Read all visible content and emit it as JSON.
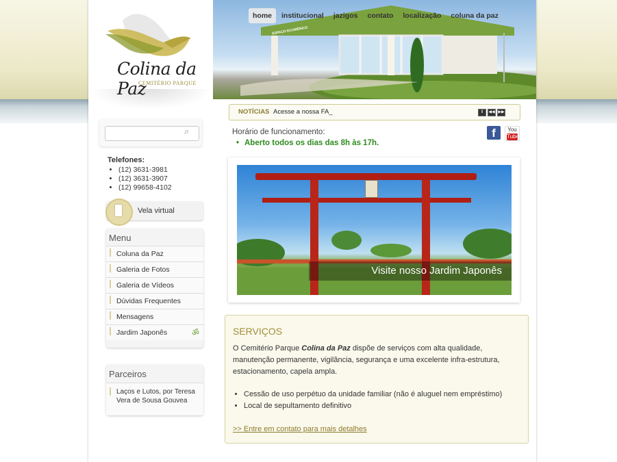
{
  "logo": {
    "name": "Colina da Paz",
    "sub": "CEMITÉRIO PARQUE"
  },
  "search": {
    "placeholder": ""
  },
  "phones": {
    "title": "Telefones:",
    "items": [
      "(12) 3631-3981",
      "(12) 3631-3907",
      "(12) 99658-4102"
    ]
  },
  "vela": {
    "label": "Vela virtual"
  },
  "menu": {
    "title": "Menu",
    "items": [
      "Coluna da Paz",
      "Galeria de Fotos",
      "Galeria de Vídeos",
      "Dúvidas Frequentes",
      "Mensagens",
      "Jardim Japonês"
    ]
  },
  "partners": {
    "title": "Parceiros",
    "items": [
      "Laços e Lutos, por Teresa Vera de Sousa Gouvea"
    ]
  },
  "nav": {
    "items": [
      "home",
      "institucional",
      "jazigos",
      "contato",
      "localização",
      "coluna da paz"
    ]
  },
  "building_sign": "ESPAÇO ECUMÊNICO",
  "ticker": {
    "label": "NOTÍCIAS",
    "text": "Acesse a nossa FA_"
  },
  "hours": {
    "label": "Horário de funcionamento:",
    "value": "Aberto todos os dias das 8h às 17h."
  },
  "social": {
    "facebook": "f",
    "youtube_you": "You",
    "youtube_tube": "Tube"
  },
  "slide": {
    "caption": "Visite nosso Jardim Japonês"
  },
  "services": {
    "title": "SERVIÇOS",
    "intro_pre": "O Cemitério Parque ",
    "intro_brand": "Colina da Paz",
    "intro_post": " dispõe de serviços com alta qualidade, manutenção permanente, vigilância, segurança e uma excelente infra-estrutura, estacionamento, capela ampla.",
    "items": [
      "Cessão de uso perpétuo da unidade familiar (não é aluguel nem empréstimo)",
      "Local de sepultamento definitivo"
    ],
    "link": ">> Entre em contato para mais detalhes"
  },
  "colors": {
    "accent": "#a38d38",
    "green": "#2e8b1d",
    "torii_red": "#b01e14"
  }
}
